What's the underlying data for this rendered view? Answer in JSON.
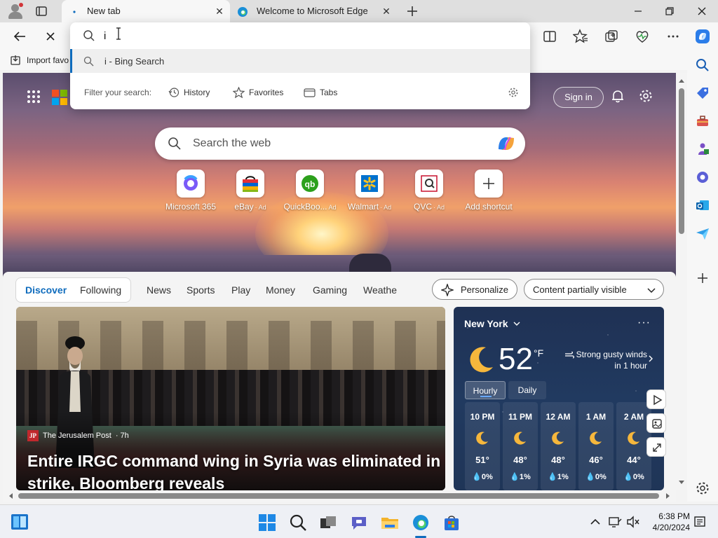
{
  "browser": {
    "tabs": [
      {
        "label": "New tab",
        "active": true
      },
      {
        "label": "Welcome to Microsoft Edge",
        "active": false
      }
    ],
    "address_bar": {
      "value": "i"
    },
    "suggestion": {
      "text": "i - Bing Search"
    },
    "filter": {
      "label": "Filter your search:",
      "chips": [
        {
          "label": "History",
          "icon": "history-icon"
        },
        {
          "label": "Favorites",
          "icon": "star-icon"
        },
        {
          "label": "Tabs",
          "icon": "tabs-icon"
        }
      ]
    },
    "favorites_bar": {
      "import_label": "Import favo"
    }
  },
  "newtab": {
    "sign_in": "Sign in",
    "search_placeholder": "Search the web",
    "shortcuts": [
      {
        "label": "Microsoft 365",
        "ad": ""
      },
      {
        "label": "eBay",
        "ad": "· Ad"
      },
      {
        "label": "QuickBoo...",
        "ad": "Ad"
      },
      {
        "label": "Walmart",
        "ad": "· Ad"
      },
      {
        "label": "QVC",
        "ad": "· Ad"
      },
      {
        "label": "Add shortcut",
        "ad": ""
      }
    ],
    "feed_tabs": [
      "Discover",
      "Following",
      "News",
      "Sports",
      "Play",
      "Money",
      "Gaming",
      "Weathe"
    ],
    "personalize": "Personalize",
    "content_visibility": "Content partially visible",
    "news": {
      "source": "The Jerusalem Post",
      "age": "· 7h",
      "source_logo": "JP",
      "headline": "Entire IRGC command wing in Syria was eliminated in strike, Bloomberg reveals"
    },
    "weather": {
      "location": "New York",
      "temperature": "52",
      "unit": "°F",
      "condition": "Strong gusty winds in 1 hour",
      "tabs": [
        "Hourly",
        "Daily"
      ],
      "hourly": [
        {
          "time": "10 PM",
          "temp": "51°",
          "rain": "0%"
        },
        {
          "time": "11 PM",
          "temp": "48°",
          "rain": "1%"
        },
        {
          "time": "12 AM",
          "temp": "48°",
          "rain": "1%"
        },
        {
          "time": "1 AM",
          "temp": "46°",
          "rain": "0%"
        },
        {
          "time": "2 AM",
          "temp": "44°",
          "rain": "0%"
        }
      ]
    }
  },
  "taskbar": {
    "time": "6:38 PM",
    "date": "4/20/2024"
  },
  "colors": {
    "accent": "#0f6cbd",
    "weather_bg": "#213a60"
  }
}
